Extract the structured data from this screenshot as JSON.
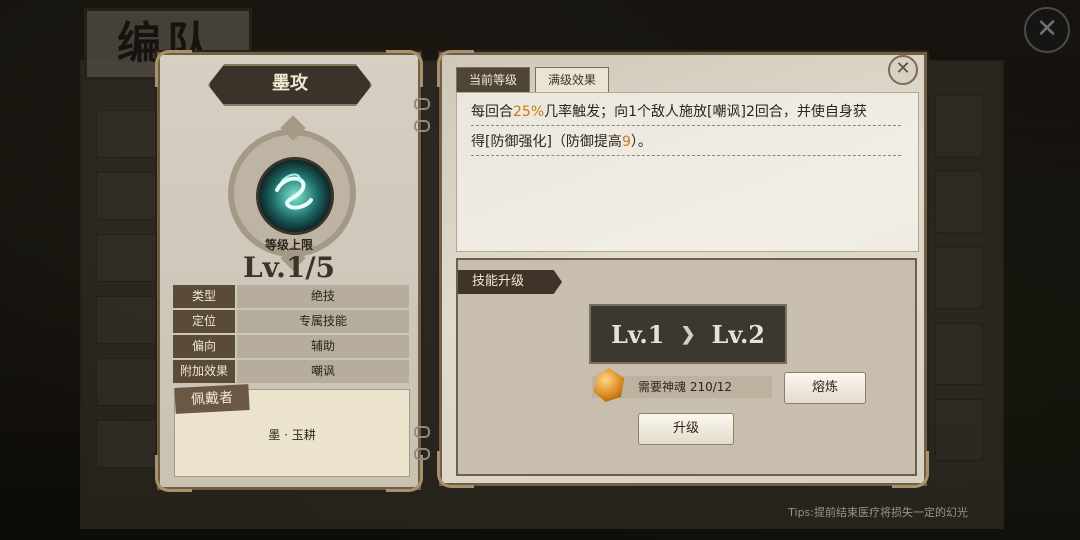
{
  "background": {
    "screen_title": "编队",
    "tips": "Tips:提前结束医疗将损失一定的幻光"
  },
  "skill_card": {
    "name": "墨攻",
    "level_cap_label": "等级上限",
    "level_value": "Lv.1/5",
    "attributes": [
      {
        "key": "类型",
        "value": "绝技"
      },
      {
        "key": "定位",
        "value": "专属技能"
      },
      {
        "key": "偏向",
        "value": "辅助"
      },
      {
        "key": "附加效果",
        "value": "嘲讽"
      }
    ],
    "wearer_label": "佩戴者",
    "wearer_name": "墨 · 玉耕"
  },
  "detail_panel": {
    "tabs": [
      {
        "label": "当前等级",
        "active": true
      },
      {
        "label": "满级效果",
        "active": false
      }
    ],
    "effect_line1": {
      "prefix": "每回合",
      "highlight": "25%",
      "suffix": "几率触发；向1个敌人施放[嘲讽]2回合，并使自身获"
    },
    "effect_line2": {
      "prefix": "得[防御强化]（防御提高",
      "highlight": "9",
      "suffix": "）。"
    },
    "upgrade_title": "技能升级",
    "from_level": "Lv.1",
    "to_level": "Lv.2",
    "requirement": "需要神魂 210/12",
    "smelt_button": "熔炼",
    "upgrade_button": "升级"
  },
  "colors": {
    "highlight": "#c97a16",
    "panel": "#d6cfc2",
    "dark_banner": "#3a332a"
  }
}
